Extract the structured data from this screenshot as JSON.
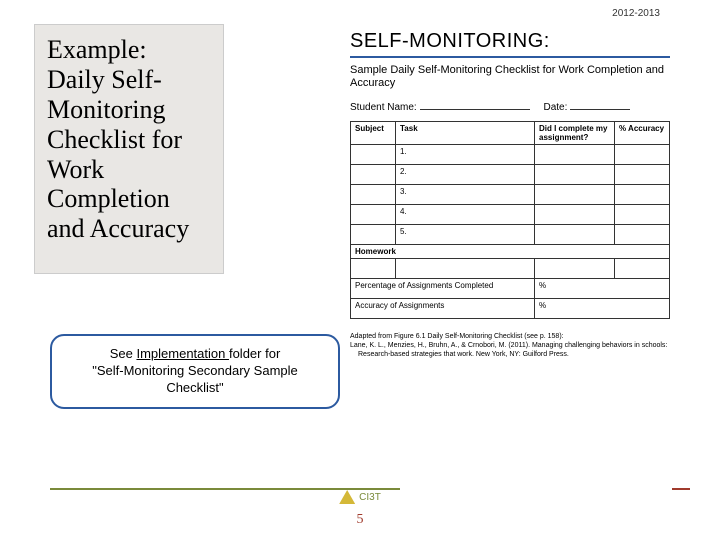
{
  "header_date": "2012-2013",
  "leftbox": {
    "title": "Example:",
    "body": "Daily Self-Monitoring Checklist for Work Completion and Accuracy"
  },
  "note": {
    "prefix": "See ",
    "underlined": "Implementation ",
    "mid": "folder for ",
    "quoted": "\"Self-Monitoring Secondary Sample Checklist\""
  },
  "doc": {
    "heading": "SELF-MONITORING:",
    "subtitle": "Sample Daily Self-Monitoring Checklist for Work Completion and Accuracy",
    "fields": {
      "student": "Student Name:",
      "date": "Date:"
    },
    "columns": {
      "subject": "Subject",
      "task": "Task",
      "did": "Did I complete my assignment?",
      "accuracy": "% Accuracy"
    },
    "rows": [
      "1.",
      "2.",
      "3.",
      "4.",
      "5."
    ],
    "homework_label": "Homework",
    "summary": {
      "completed": "Percentage of Assignments Completed",
      "accuracy": "Accuracy of Assignments",
      "unit": "%"
    },
    "adapted": {
      "l1": "Adapted from Figure 6.1 Daily Self-Monitoring Checklist (see p. 158):",
      "l2": "Lane, K. L., Menzies, H., Bruhn, A., & Crnobori, M. (2011). Managing challenging behaviors in schools:",
      "l3": "Research-based strategies that work. New York, NY: Guilford Press."
    }
  },
  "footer": {
    "logo_text": "CI3T",
    "page": "5"
  }
}
